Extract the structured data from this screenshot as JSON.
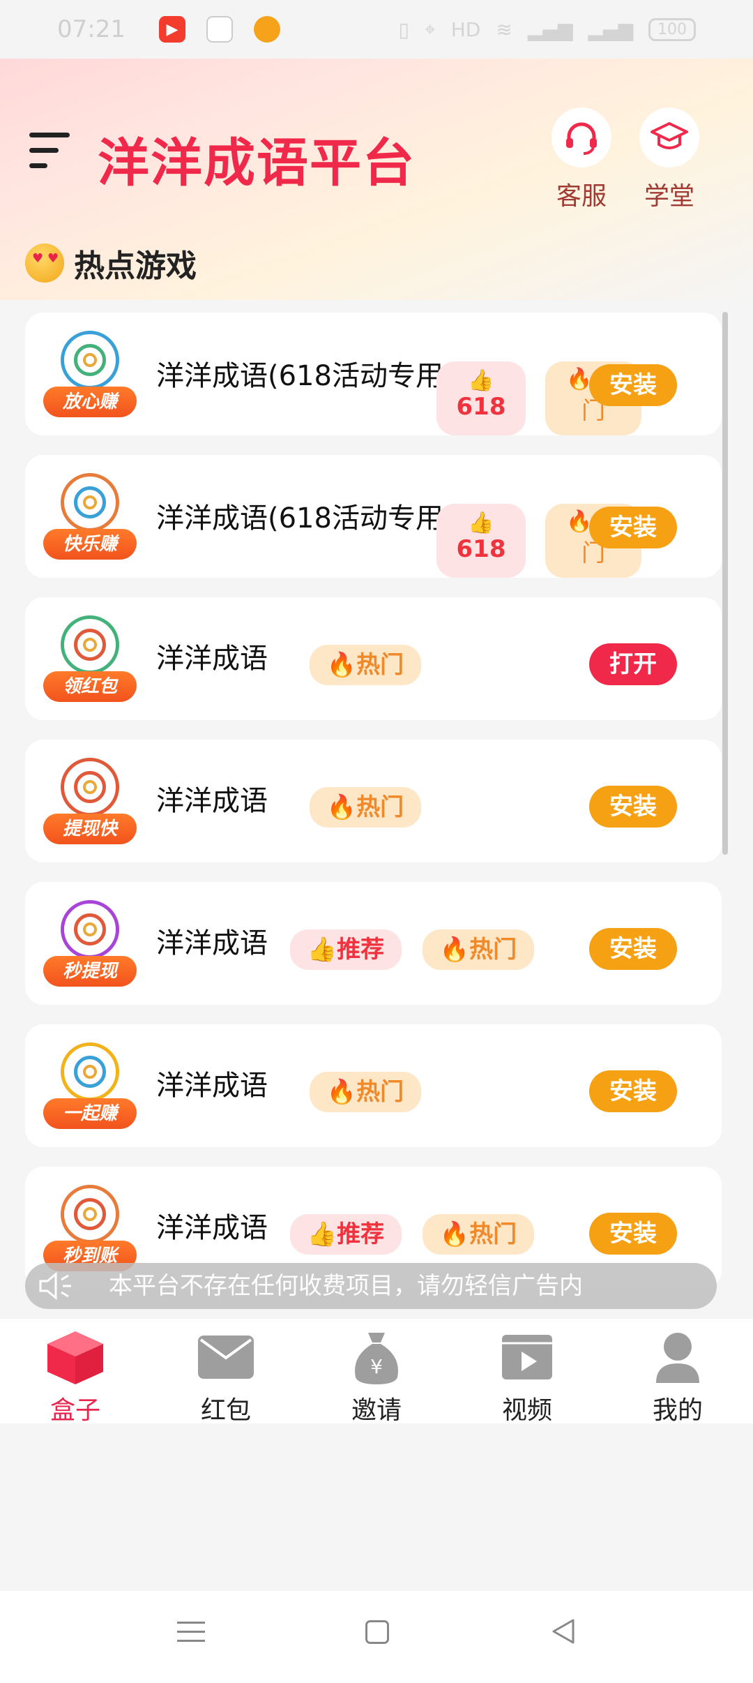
{
  "status": {
    "time": "07:21",
    "battery": "100"
  },
  "header": {
    "title": "洋洋成语平台",
    "service_label": "客服",
    "school_label": "学堂"
  },
  "section": {
    "title": "热点游戏"
  },
  "badges": {
    "like_618": "618",
    "hot_split_top": "",
    "hot_split_bottom": "门",
    "hot": "热门",
    "recommend": "推荐"
  },
  "games": [
    {
      "logo_tag": "放心赚",
      "name": "洋洋成语(618活动专用)",
      "badges": [
        "618",
        "热门"
      ],
      "action": "安装"
    },
    {
      "logo_tag": "快乐赚",
      "name": "洋洋成语(618活动专用)",
      "badges": [
        "618",
        "热门"
      ],
      "action": "安装"
    },
    {
      "logo_tag": "领红包",
      "name": "洋洋成语",
      "badges": [
        "热门"
      ],
      "action": "打开"
    },
    {
      "logo_tag": "提现快",
      "name": "洋洋成语",
      "badges": [
        "热门"
      ],
      "action": "安装"
    },
    {
      "logo_tag": "秒提现",
      "name": "洋洋成语",
      "badges": [
        "推荐",
        "热门"
      ],
      "action": "安装"
    },
    {
      "logo_tag": "一起赚",
      "name": "洋洋成语",
      "badges": [
        "热门"
      ],
      "action": "安装"
    },
    {
      "logo_tag": "秒到账",
      "name": "洋洋成语",
      "badges": [
        "推荐",
        "热门"
      ],
      "action": "安装"
    }
  ],
  "notice": {
    "text": "本平台不存在任何收费项目，请勿轻信广告内"
  },
  "tabs": [
    {
      "label": "盒子",
      "icon": "box-icon"
    },
    {
      "label": "红包",
      "icon": "envelope-icon"
    },
    {
      "label": "邀请",
      "icon": "money-bag-icon"
    },
    {
      "label": "视频",
      "icon": "video-icon"
    },
    {
      "label": "我的",
      "icon": "user-icon"
    }
  ],
  "colors": {
    "brand": "#f0284a",
    "install": "#f6a013",
    "open": "#f0284a",
    "active_tab": "#e8254c"
  }
}
